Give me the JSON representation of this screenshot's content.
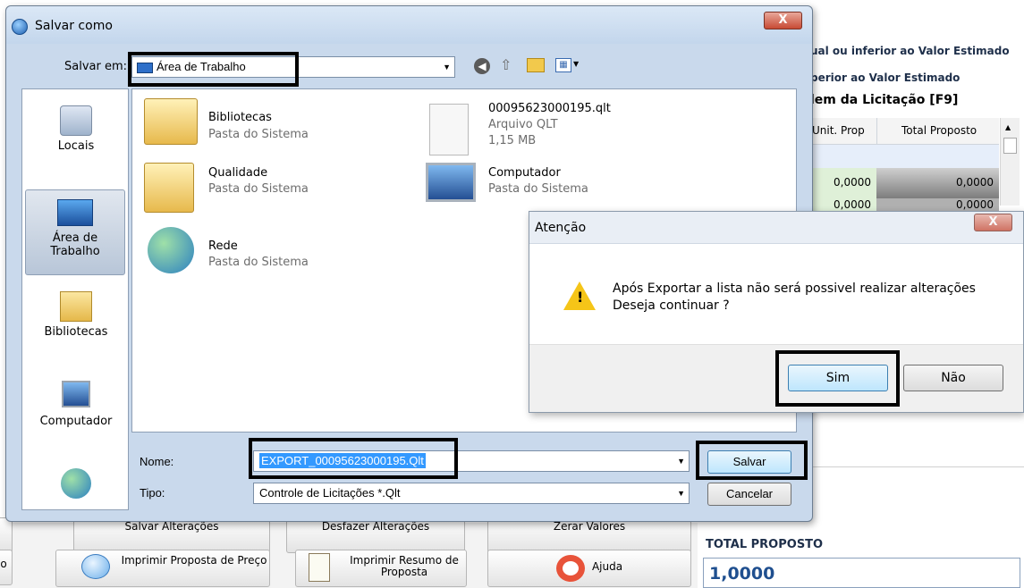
{
  "background_app": {
    "line1": "ual ou inferior ao Valor Estimado",
    "line2": "perior ao Valor Estimado",
    "section_title": "lem da Licitação [F9]",
    "grid": {
      "headers": [
        "Unit. Prop",
        "Total Proposto"
      ],
      "rows": [
        [
          "0,0000",
          "0,0000"
        ],
        [
          "0,0000",
          "0,0000"
        ]
      ]
    },
    "toolbar": {
      "save_changes": "Salvar Alterações",
      "undo_changes": "Desfazer Alterações",
      "zero_values": "Zerar Valores",
      "print_price_proposal": "Imprimir Proposta de Preço",
      "print_summary": "Imprimir Resumo de Proposta",
      "help": "Ajuda",
      "left_partial": "o"
    },
    "total_label": "TOTAL PROPOSTO",
    "total_value": "1,0000"
  },
  "save_dialog": {
    "title": "Salvar como",
    "close": "X",
    "save_in_label": "Salvar em:",
    "save_in_value": "Área de Trabalho",
    "places": [
      "Locais",
      "Área de Trabalho",
      "Bibliotecas",
      "Computador"
    ],
    "files": [
      {
        "name": "Bibliotecas",
        "type": "Pasta do Sistema"
      },
      {
        "name": "00095623000195.qlt",
        "type": "Arquivo QLT",
        "size": "1,15 MB"
      },
      {
        "name": "Qualidade",
        "type": "Pasta do Sistema"
      },
      {
        "name": "Computador",
        "type": "Pasta do Sistema"
      },
      {
        "name": "Rede",
        "type": "Pasta do Sistema"
      }
    ],
    "name_label": "Nome:",
    "name_value": "EXPORT_00095623000195.Qlt",
    "type_label": "Tipo:",
    "type_value": "Controle de Licitações   *.Qlt",
    "save_button": "Salvar",
    "cancel_button": "Cancelar"
  },
  "alert_dialog": {
    "title": "Atenção",
    "close": "X",
    "message_line1": "Após Exportar a lista não será possivel realizar alterações",
    "message_line2": "Deseja continuar ?",
    "yes_button": "Sim",
    "no_button": "Não"
  },
  "colors": {
    "selection_blue": "#3399ff",
    "dialog_chrome": "#c9d9ec",
    "highlight_frame": "#000000"
  }
}
